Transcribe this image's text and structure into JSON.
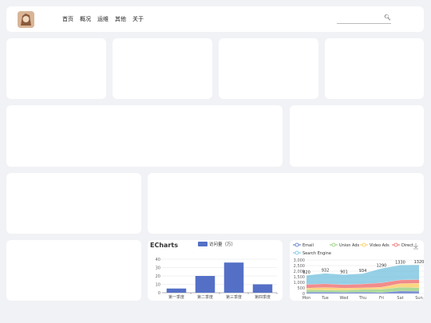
{
  "nav": {
    "items": [
      "首页",
      "概况",
      "运维",
      "其他",
      "关于"
    ],
    "search_placeholder": ""
  },
  "bar_chart": {
    "title": "ECharts",
    "legend": "访问量（万）",
    "categories": [
      "第一季度",
      "第二季度",
      "第三季度",
      "第四季度"
    ],
    "values": [
      5,
      20,
      36,
      10
    ],
    "yticks": [
      "0",
      "10",
      "20",
      "30",
      "40"
    ],
    "color": "#5470c6"
  },
  "area_chart": {
    "legend": [
      "Email",
      "Union Ads",
      "Video Ads",
      "Direct",
      "Search Engine"
    ],
    "days": [
      "Mon",
      "Tue",
      "Wed",
      "Thu",
      "Fri",
      "Sat",
      "Sun"
    ],
    "yticks": [
      "0",
      "500",
      "1,000",
      "1,500",
      "2,000",
      "2,500",
      "3,000"
    ],
    "top_labels": [
      "820",
      "932",
      "901",
      "934",
      "1290",
      "1330",
      "1320"
    ]
  },
  "chart_data": [
    {
      "type": "bar",
      "title": "ECharts",
      "categories": [
        "第一季度",
        "第二季度",
        "第三季度",
        "第四季度"
      ],
      "series": [
        {
          "name": "访问量（万）",
          "values": [
            5,
            20,
            36,
            10
          ]
        }
      ],
      "ylim": [
        0,
        40
      ],
      "grid": true,
      "legend_position": "top-center"
    },
    {
      "type": "area",
      "categories": [
        "Mon",
        "Tue",
        "Wed",
        "Thu",
        "Fri",
        "Sat",
        "Sun"
      ],
      "series": [
        {
          "name": "Email",
          "values": [
            120,
            132,
            101,
            134,
            90,
            230,
            210
          ],
          "color": "#5470c6"
        },
        {
          "name": "Union Ads",
          "values": [
            220,
            182,
            191,
            234,
            290,
            330,
            310
          ],
          "color": "#91cc75"
        },
        {
          "name": "Video Ads",
          "values": [
            150,
            232,
            201,
            154,
            190,
            330,
            410
          ],
          "color": "#fac858"
        },
        {
          "name": "Direct",
          "values": [
            320,
            332,
            301,
            334,
            390,
            330,
            320
          ],
          "color": "#ee6666"
        },
        {
          "name": "Search Engine",
          "values": [
            820,
            932,
            901,
            934,
            1290,
            1330,
            1320
          ],
          "color": "#73c0de"
        }
      ],
      "ylim": [
        0,
        3000
      ],
      "stacked": true,
      "grid": true,
      "legend_position": "top"
    }
  ]
}
